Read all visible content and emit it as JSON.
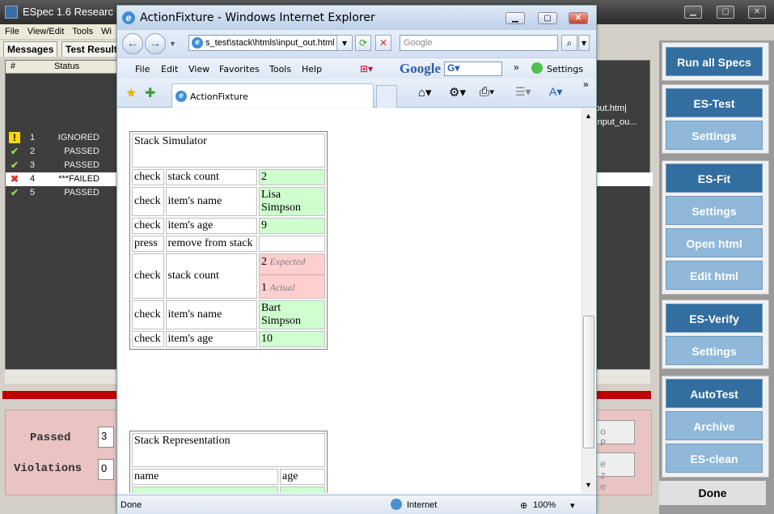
{
  "bg_app": {
    "title": "ESpec 1.6 Researc",
    "menu": [
      "File",
      "View/Edit",
      "Tools",
      "Wi"
    ],
    "tabs": [
      "Messages",
      "Test Result"
    ],
    "columns": [
      "#",
      "Status"
    ],
    "rows": [
      {
        "num": "1",
        "status": "IGNORED",
        "icon": "!",
        "path": ""
      },
      {
        "num": "2",
        "status": "PASSED",
        "icon": "✔",
        "path": ""
      },
      {
        "num": "3",
        "status": "PASSED",
        "icon": "✔",
        "path": ""
      },
      {
        "num": "4",
        "status": "***FAILED",
        "icon": "✖",
        "path": ""
      },
      {
        "num": "5",
        "status": "PASSED",
        "icon": "✔",
        "path": ""
      }
    ],
    "path_snippets": [
      "iput.htm|",
      "\\input_ou..."
    ],
    "stats": {
      "passed_label": "Passed",
      "passed_value": "3",
      "violations_label": "Violations",
      "violations_value": "0",
      "stop_label": "o P",
      "freeze_label": "e z e"
    }
  },
  "panel": {
    "run_all": "Run all Specs",
    "es_test": "ES-Test",
    "settings": "Settings",
    "es_fit": "ES-Fit",
    "open_html": "Open html",
    "edit_html": "Edit html",
    "es_verify": "ES-Verify",
    "autotest": "AutoTest",
    "archive": "Archive",
    "es_clean": "ES-clean",
    "done": "Done"
  },
  "ie": {
    "title": "ActionFixture - Windows Internet Explorer",
    "address": "s_test\\stack\\htmls\\input_out.html",
    "search_placeholder": "Google",
    "menu": [
      "File",
      "Edit",
      "View",
      "Favorites",
      "Tools",
      "Help"
    ],
    "google": "Google",
    "settings": "Settings",
    "tab_label": "ActionFixture",
    "status_left": "Done",
    "status_zone": "Internet",
    "zoom": "100%"
  },
  "fixture": {
    "title": "Stack Simulator",
    "rows": [
      {
        "a": "check",
        "b": "stack count",
        "c": "2",
        "result": "pass"
      },
      {
        "a": "check",
        "b": "item's name",
        "c": "Lisa Simpson",
        "result": "pass"
      },
      {
        "a": "check",
        "b": "item's age",
        "c": "9",
        "result": "pass"
      },
      {
        "a": "press",
        "b": "remove from stack",
        "c": "",
        "result": "none"
      },
      {
        "a": "check",
        "b": "stack count",
        "expected": "2",
        "actual": "1",
        "result": "fail"
      },
      {
        "a": "check",
        "b": "item's name",
        "c": "Bart Simpson",
        "result": "pass"
      },
      {
        "a": "check",
        "b": "item's age",
        "c": "10",
        "result": "pass"
      }
    ],
    "expected_label": "Expected",
    "actual_label": "Actual"
  },
  "representation": {
    "title": "Stack Representation",
    "col_name": "name",
    "col_age": "age"
  }
}
